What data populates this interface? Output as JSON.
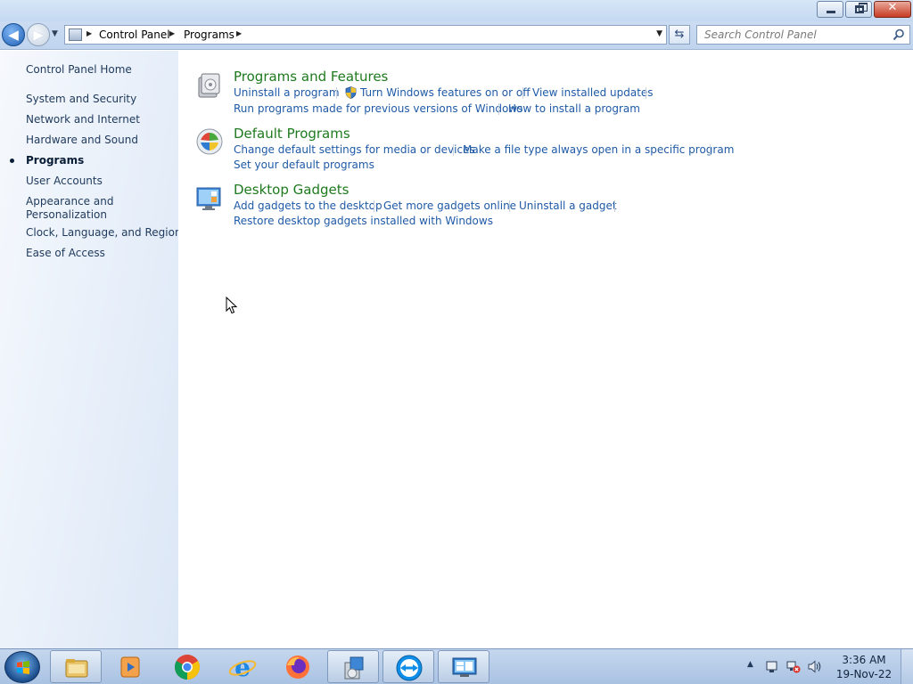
{
  "window": {
    "minimize_icon": "minimize-icon",
    "maximize_icon": "restore-icon",
    "close_icon": "close-icon",
    "close_glyph": "✕"
  },
  "nav": {
    "back_glyph": "◀",
    "forward_glyph": "▶",
    "breadcrumb": [
      "Control Panel",
      "Programs"
    ],
    "search_placeholder": "Search Control Panel"
  },
  "sidebar": {
    "items": [
      {
        "label": "Control Panel Home"
      },
      {
        "label": "System and Security"
      },
      {
        "label": "Network and Internet"
      },
      {
        "label": "Hardware and Sound"
      },
      {
        "label": "Programs"
      },
      {
        "label": "User Accounts"
      },
      {
        "label": "Appearance and"
      },
      {
        "label": "Personalization"
      },
      {
        "label": "Clock, Language, and Region"
      },
      {
        "label": "Ease of Access"
      }
    ],
    "active": "Programs"
  },
  "categories": [
    {
      "title": "Programs and Features",
      "links": [
        "Uninstall a program",
        "Turn Windows features on or off",
        "View installed updates",
        "Run programs made for previous versions of Windows",
        "How to install a program"
      ]
    },
    {
      "title": "Default Programs",
      "links": [
        "Change default settings for media or devices",
        "Make a file type always open in a specific program",
        "Set your default programs"
      ]
    },
    {
      "title": "Desktop Gadgets",
      "links": [
        "Add gadgets to the desktop",
        "Get more gadgets online",
        "Uninstall a gadget",
        "Restore desktop gadgets installed with Windows"
      ]
    }
  ],
  "taskbar": {
    "apps": [
      "windows-explorer",
      "media-center",
      "google-chrome",
      "internet-explorer",
      "firefox",
      "control-panel-programs",
      "teamviewer",
      "remote-desktop"
    ],
    "clock_time": "3:36 AM",
    "clock_date": "19-Nov-22"
  },
  "colors": {
    "link": "#1f5aa6",
    "category_title": "#1e7a1e",
    "sidebar_bg": "#e6eef9"
  }
}
